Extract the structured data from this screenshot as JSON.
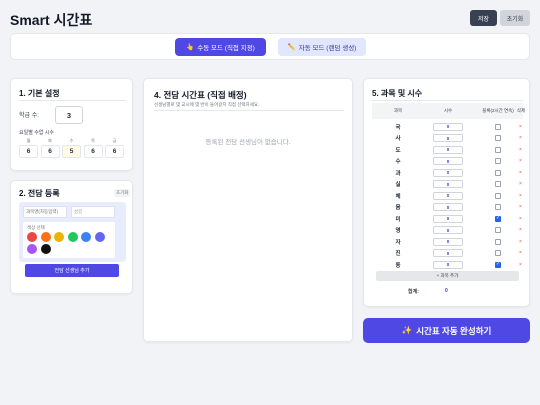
{
  "app": {
    "title": "Smart 시간표"
  },
  "header": {
    "save_label": "저장",
    "reset_label": "초기화"
  },
  "modes": {
    "manual": {
      "icon": "pointing-hand-icon",
      "label": "수동 모드 (직접 지정)"
    },
    "auto": {
      "icon": "pencil-icon",
      "label": "자동 모드 (랜덤 생성)"
    },
    "active": "manual"
  },
  "basic": {
    "title": "1. 기본 설정",
    "classes_label": "학급 수:",
    "classes_value": "3",
    "daily_label": "요일별 수업 시수",
    "days": [
      {
        "label": "월",
        "value": "6"
      },
      {
        "label": "화",
        "value": "6"
      },
      {
        "label": "수",
        "value": "5"
      },
      {
        "label": "목",
        "value": "6"
      },
      {
        "label": "금",
        "value": "6"
      }
    ]
  },
  "teacher": {
    "title": "2. 전담 등록",
    "reset_label": "초기화",
    "subject_placeholder": "과목명(자동입력)",
    "name_placeholder": "성함",
    "color_label": "색상 선택",
    "colors": [
      "#ef4444",
      "#f97316",
      "#eab308",
      "#22c55e",
      "#3b82f6",
      "#6366f1",
      "#a855f7",
      "#111111"
    ],
    "add_label": "전담 선생님 추가"
  },
  "assign": {
    "title": "4. 전담 시간표 (직접 배정)",
    "subtitle": "선생님별로 몇 교시에 몇 반이 들어갈지 직접 선택하세요.",
    "empty_message": "등록된 전담 선생님이 없습니다."
  },
  "subjects": {
    "title": "5. 과목 및 시수",
    "headers": {
      "subject": "과목",
      "hours": "시수",
      "block": "블록(2시간 연속)",
      "delete": "삭제"
    },
    "rows": [
      {
        "name": "국",
        "hours": "0",
        "block": false
      },
      {
        "name": "사",
        "hours": "0",
        "block": false
      },
      {
        "name": "도",
        "hours": "0",
        "block": false
      },
      {
        "name": "수",
        "hours": "0",
        "block": false
      },
      {
        "name": "과",
        "hours": "0",
        "block": false
      },
      {
        "name": "실",
        "hours": "0",
        "block": false
      },
      {
        "name": "체",
        "hours": "0",
        "block": false
      },
      {
        "name": "음",
        "hours": "0",
        "block": false
      },
      {
        "name": "미",
        "hours": "0",
        "block": true
      },
      {
        "name": "영",
        "hours": "0",
        "block": false
      },
      {
        "name": "자",
        "hours": "0",
        "block": false
      },
      {
        "name": "진",
        "hours": "0",
        "block": false
      },
      {
        "name": "동",
        "hours": "0",
        "block": true
      }
    ],
    "delete_symbol": "×",
    "add_label": "+ 과목 추가",
    "sum_label": "합계:",
    "sum_value": "0"
  },
  "complete": {
    "icon": "sparkles-icon",
    "label": "시간표 자동 완성하기"
  }
}
